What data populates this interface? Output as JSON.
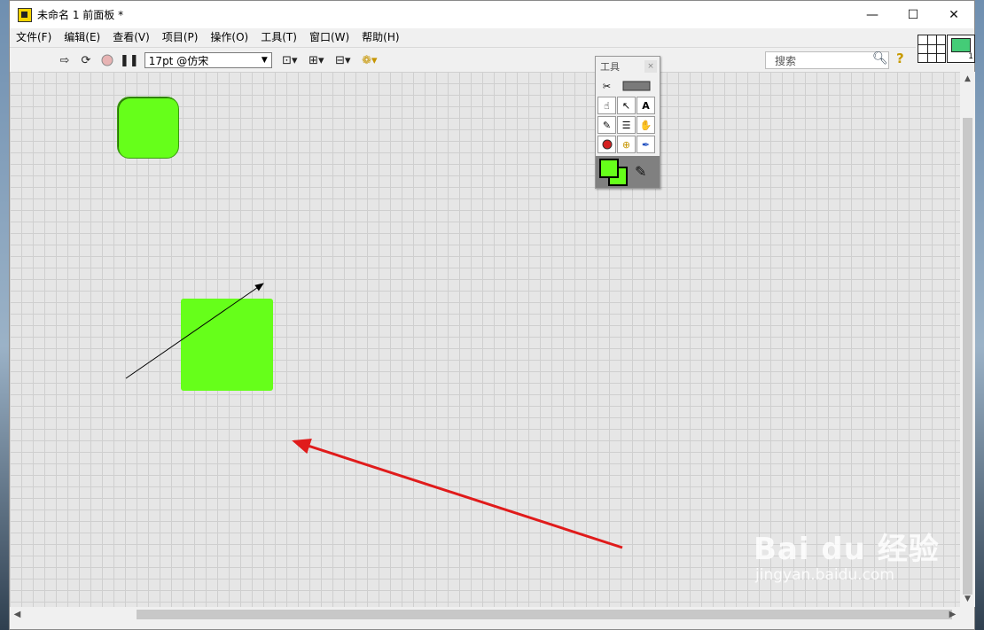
{
  "window": {
    "title": "未命名 1 前面板 *",
    "controls": {
      "minimize": "—",
      "maximize": "☐",
      "close": "✕"
    }
  },
  "menu": [
    "文件(F)",
    "编辑(E)",
    "查看(V)",
    "项目(P)",
    "操作(O)",
    "工具(T)",
    "窗口(W)",
    "帮助(H)"
  ],
  "toolbar": {
    "font": "17pt @仿宋",
    "search_placeholder": "搜索",
    "help": "?"
  },
  "tools_palette": {
    "title": "工具",
    "close": "×"
  },
  "colors": {
    "shape_fill": "#66ff1a",
    "annotation_arrow": "#e01b1b",
    "drawn_arrow": "#000000"
  },
  "watermark": {
    "brand": "Bai du 经验",
    "url": "jingyan.baidu.com"
  }
}
